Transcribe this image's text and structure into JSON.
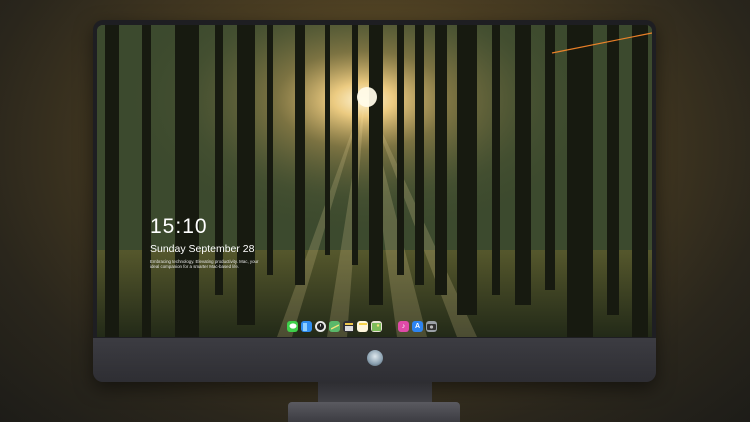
{
  "lock_screen": {
    "time": "15:10",
    "date": "Sunday September 28",
    "caption": "Embracing technology. Elevating productivity. Mac, your ideal companion for a smarter Mac-based life."
  },
  "dock": {
    "apps": [
      {
        "name": "messages-icon",
        "glyph": "",
        "color": "#3ecf4a"
      },
      {
        "name": "finder-icon",
        "glyph": "",
        "color": "#2f8df0"
      },
      {
        "name": "clock-icon",
        "glyph": "",
        "color": "#e8e8e8"
      },
      {
        "name": "maps-icon",
        "glyph": "",
        "color": "#5ab86a"
      },
      {
        "name": "clapper-icon",
        "glyph": "",
        "color": "#2f2f35"
      },
      {
        "name": "notes-icon",
        "glyph": "",
        "color": "#f7d44a"
      },
      {
        "name": "photos-icon",
        "glyph": "",
        "color": "#7dbb5a"
      },
      {
        "name": "music-icon",
        "glyph": "♪",
        "color": "#e04aa8"
      },
      {
        "name": "app-store-icon",
        "glyph": "A",
        "color": "#2d84f0"
      },
      {
        "name": "camera-icon",
        "glyph": "",
        "color": "#9aa0a6"
      }
    ]
  }
}
